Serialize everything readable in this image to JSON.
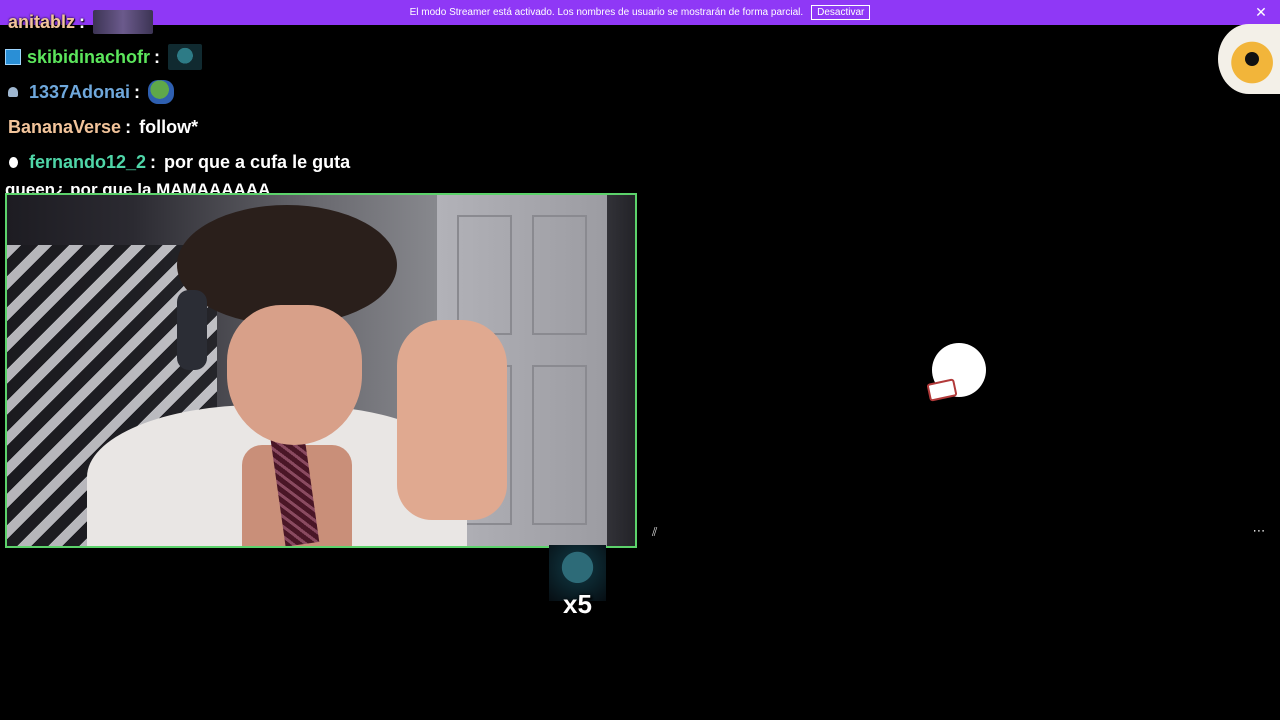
{
  "banner": {
    "text": "El modo Streamer está activado. Los nombres de usuario se mostrarán de forma parcial.",
    "button_label": "Desactivar",
    "close_glyph": "✕",
    "background": "#8f38f6"
  },
  "chat": {
    "messages": [
      {
        "user": "anitablz",
        "color": "#f2c49b",
        "separator": ":",
        "text": "",
        "emote": "group-photo-emote",
        "badge": ""
      },
      {
        "user": "skibidinachofr",
        "color": "#5ce65c",
        "separator": ":",
        "text": "",
        "emote": "fish-emote",
        "badge": "prime-badge"
      },
      {
        "user": "1337Adonai",
        "color": "#6fa8dc",
        "separator": ":",
        "text": "",
        "emote": "pepe-emote",
        "badge": "sub-badge"
      },
      {
        "user": "BananaVerse",
        "color": "#f2c49b",
        "separator": ":",
        "text": "follow*",
        "emote": "",
        "badge": ""
      },
      {
        "user": "fernando12_2",
        "color": "#4fd6a8",
        "separator": ":",
        "text": "por que a cufa le guta",
        "emote": "",
        "badge": "dot-badge"
      }
    ],
    "wrapped_line": "queen¿ por que la MAMAAAAAA"
  },
  "overlay": {
    "combo_count": "x5",
    "combo_emote": "fish-emote",
    "webcam_border": "#5cd26b",
    "more_glyph": "⋯",
    "cursor_glyph": "⫽"
  }
}
